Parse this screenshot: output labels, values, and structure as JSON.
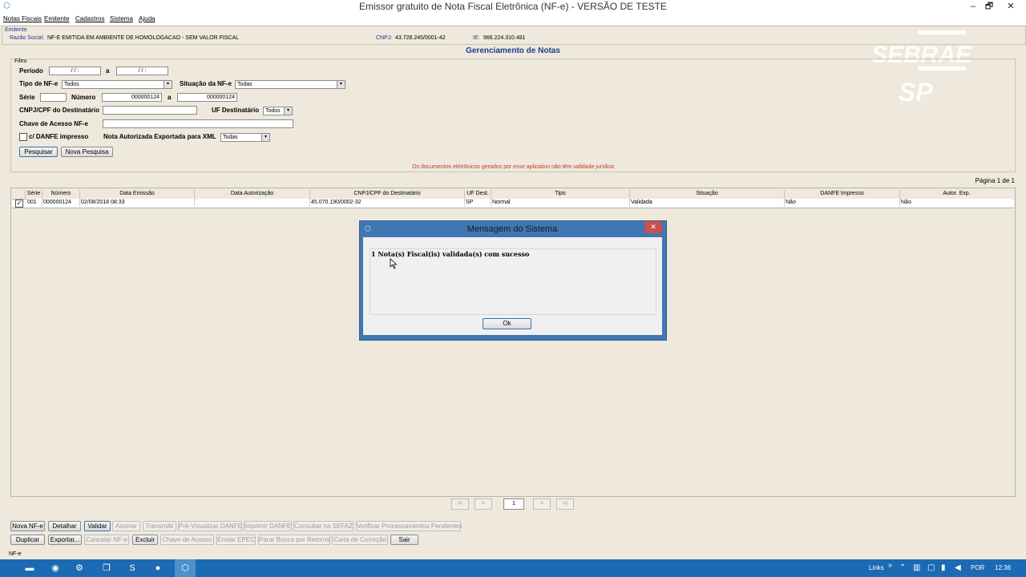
{
  "window": {
    "title": "Emissor gratuito de Nota Fiscal Eletrônica (NF-e) - VERSÃO DE TESTE",
    "minimize": "–",
    "maximize": "🗗",
    "close": "✕"
  },
  "menu": [
    "Notas Fiscais",
    "Emitente",
    "Cadastros",
    "Sistema",
    "Ajuda"
  ],
  "emitente": {
    "section_label": "Emitente",
    "razao_label": "Razão Social:",
    "razao_value": "NF-E EMITIDA EM AMBIENTE DE HOMOLOGACAO - SEM VALOR FISCAL",
    "cnpj_label": "CNPJ:",
    "cnpj_value": "43.728.245/0001-42",
    "ie_label": "IE:",
    "ie_value": "966.224.310.481"
  },
  "page_title": "Gerenciamento de Notas",
  "logo": {
    "line1": "SEBRAE",
    "line2": "SP"
  },
  "filter": {
    "section_label": "Filtro",
    "periodo_label": "Período",
    "periodo_from": " / /      :",
    "periodo_a": "a",
    "periodo_to": " / /      :",
    "tipo_label": "Tipo de NF-e",
    "tipo_value": "Todos",
    "situacao_label": "Situação da NF-e",
    "situacao_value": "Todas",
    "serie_label": "Série",
    "serie_value": "",
    "numero_label": "Número",
    "numero_from": "000000124",
    "numero_a": "a",
    "numero_to": "000000124",
    "cnpj_dest_label": "CNPJ/CPF do Destinatário",
    "cnpj_dest_value": "",
    "uf_label": "UF Destinatário",
    "uf_value": "Todos",
    "chave_label": "Chave de Acesso NF-e",
    "chave_value": "",
    "danfe_check_label": "c/ DANFE impresso",
    "xml_label": "Nota Autorizada Exportada para XML",
    "xml_value": "Todas",
    "pesquisar": "Pesquisar",
    "nova_pesquisa": "Nova Pesquisa",
    "warning": "Os documentos eletrônicos gerados por esse aplicativo não têm validade jurídica"
  },
  "pagination": {
    "label": "Página 1 de 1",
    "first": "|<",
    "prev": "<",
    "current": "1",
    "next": ">",
    "last": ">|"
  },
  "grid": {
    "headers": [
      "Série",
      "Número",
      "Data Emissão",
      "Data Autorização",
      "CNPJ/CPF do Destinatário",
      "UF Dest.",
      "Tipo",
      "Situação",
      "DANFE Impresso",
      "Autor. Exp."
    ],
    "row": {
      "checked": "✓",
      "serie": "001",
      "numero": "000000124",
      "data_emissao": "02/08/2018 08:33",
      "data_autorizacao": "",
      "cnpj_dest": "45.070.190/0002-32",
      "uf": "SP",
      "tipo": "Normal",
      "situacao": "Validada",
      "danfe": "Não",
      "autor_exp": "Não"
    }
  },
  "dialog": {
    "title": "Mensagem do Sistema",
    "message": "1 Nota(s) Fiscal(is) validada(s) com sucesso",
    "ok": "Ok",
    "close": "✕"
  },
  "actions_row1": [
    "Nova NF-e",
    "Detalhar",
    "Validar",
    "Assinar",
    "Transmitir",
    "Pré-Visualizar DANFE",
    "Imprimir DANFE",
    "Consultar na SEFAZ",
    "Verificar Processamentos Pendentes"
  ],
  "actions_row2": [
    "Duplicar",
    "Exportar...",
    "Cancelar NF-e",
    "Excluir",
    "Chave de Acesso",
    "Enviar EPEC",
    "Parar Busca por Retorno",
    "Carta de Correção",
    "Sair"
  ],
  "statusbar": "NF-e",
  "taskbar": {
    "links": "Links",
    "chevron": "»",
    "lang": "POR",
    "time": "12:36"
  },
  "colors": {
    "accent_blue": "#1b6ab3",
    "dialog_frame": "#3f76b3",
    "warning_red": "#c0392b",
    "title_blue": "#1f3b8f"
  }
}
